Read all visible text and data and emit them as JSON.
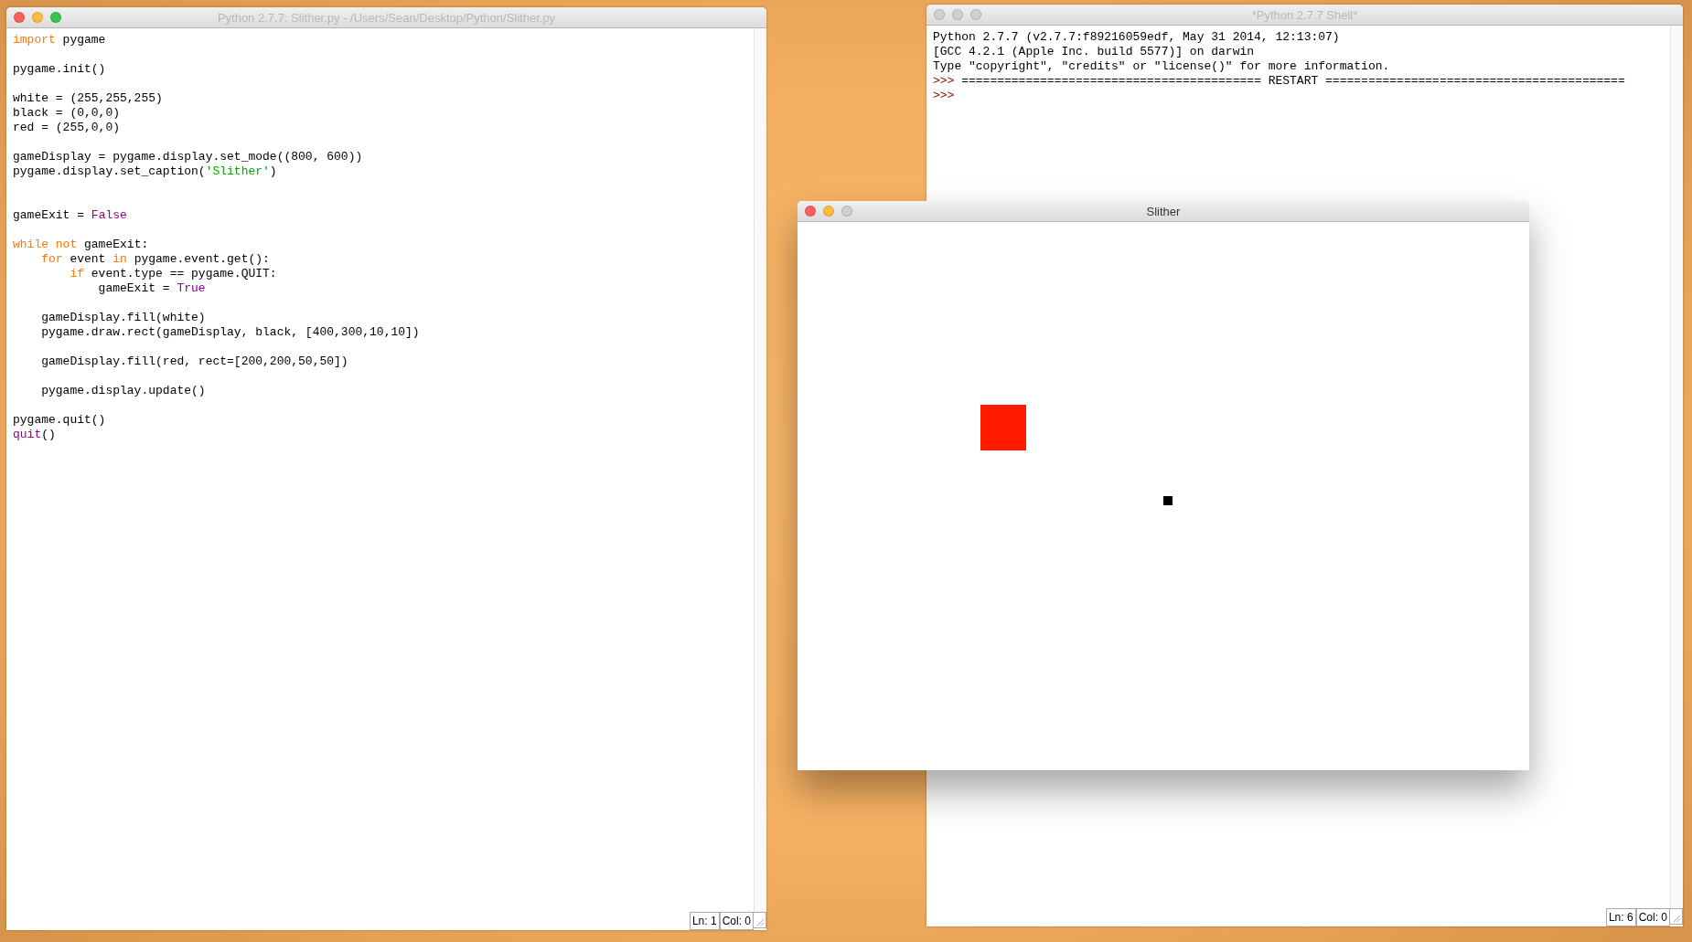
{
  "editor": {
    "title": "Python 2.7.7: Slither.py - /Users/Sean/Desktop/Python/Slither.py",
    "lines": [
      {
        "kind": "code",
        "tokens": [
          {
            "kind": "keyword",
            "text": "import"
          },
          {
            "kind": "plain",
            "text": " pygame"
          }
        ]
      },
      {
        "kind": "blank"
      },
      {
        "kind": "code",
        "tokens": [
          {
            "kind": "plain",
            "text": "pygame.init()"
          }
        ]
      },
      {
        "kind": "blank"
      },
      {
        "kind": "code",
        "tokens": [
          {
            "kind": "plain",
            "text": "white = (255,255,255)"
          }
        ]
      },
      {
        "kind": "code",
        "tokens": [
          {
            "kind": "plain",
            "text": "black = (0,0,0)"
          }
        ]
      },
      {
        "kind": "code",
        "tokens": [
          {
            "kind": "plain",
            "text": "red = (255,0,0)"
          }
        ]
      },
      {
        "kind": "blank"
      },
      {
        "kind": "code",
        "tokens": [
          {
            "kind": "plain",
            "text": "gameDisplay = pygame.display.set_mode((800, 600))"
          }
        ]
      },
      {
        "kind": "code",
        "tokens": [
          {
            "kind": "plain",
            "text": "pygame.display.set_caption("
          },
          {
            "kind": "string",
            "text": "'Slither'"
          },
          {
            "kind": "plain",
            "text": ")"
          }
        ]
      },
      {
        "kind": "blank"
      },
      {
        "kind": "blank"
      },
      {
        "kind": "code",
        "tokens": [
          {
            "kind": "plain",
            "text": "gameExit = "
          },
          {
            "kind": "builtin",
            "text": "False"
          }
        ]
      },
      {
        "kind": "blank"
      },
      {
        "kind": "code",
        "tokens": [
          {
            "kind": "keyword",
            "text": "while not"
          },
          {
            "kind": "plain",
            "text": " gameExit:"
          }
        ]
      },
      {
        "kind": "code",
        "tokens": [
          {
            "kind": "keyword",
            "text": "    for"
          },
          {
            "kind": "plain",
            "text": " event "
          },
          {
            "kind": "keyword",
            "text": "in"
          },
          {
            "kind": "plain",
            "text": " pygame.event.get():"
          }
        ]
      },
      {
        "kind": "code",
        "tokens": [
          {
            "kind": "keyword",
            "text": "        if"
          },
          {
            "kind": "plain",
            "text": " event.type == pygame.QUIT:"
          }
        ]
      },
      {
        "kind": "code",
        "tokens": [
          {
            "kind": "plain",
            "text": "            gameExit = "
          },
          {
            "kind": "builtin",
            "text": "True"
          }
        ]
      },
      {
        "kind": "blank"
      },
      {
        "kind": "code",
        "tokens": [
          {
            "kind": "plain",
            "text": "    gameDisplay.fill(white)"
          }
        ]
      },
      {
        "kind": "code",
        "tokens": [
          {
            "kind": "plain",
            "text": "    pygame.draw.rect(gameDisplay, black, [400,300,10,10])"
          }
        ]
      },
      {
        "kind": "blank"
      },
      {
        "kind": "code",
        "tokens": [
          {
            "kind": "plain",
            "text": "    gameDisplay.fill(red, rect=[200,200,50,50])"
          }
        ]
      },
      {
        "kind": "blank"
      },
      {
        "kind": "code",
        "tokens": [
          {
            "kind": "plain",
            "text": "    pygame.display.update()"
          }
        ]
      },
      {
        "kind": "blank"
      },
      {
        "kind": "code",
        "tokens": [
          {
            "kind": "plain",
            "text": "pygame.quit()"
          }
        ]
      },
      {
        "kind": "code",
        "tokens": [
          {
            "kind": "builtin",
            "text": "quit"
          },
          {
            "kind": "plain",
            "text": "()"
          }
        ]
      }
    ],
    "status": {
      "line": "Ln: 1",
      "column": "Col: 0"
    }
  },
  "shell": {
    "title": "*Python 2.7.7 Shell*",
    "lines": [
      [
        {
          "kind": "output",
          "text": "Python 2.7.7 (v2.7.7:f89216059edf, May 31 2014, 12:13:07)"
        }
      ],
      [
        {
          "kind": "output",
          "text": "[GCC 4.2.1 (Apple Inc. build 5577)] on darwin"
        }
      ],
      [
        {
          "kind": "output",
          "text": "Type \"copyright\", \"credits\" or \"license()\" for more information."
        }
      ],
      [
        {
          "kind": "prompt",
          "text": ">>>"
        },
        {
          "kind": "output",
          "text": " ========================================== RESTART =========================================="
        }
      ],
      [
        {
          "kind": "prompt",
          "text": ">>>"
        }
      ]
    ],
    "status": {
      "line": "Ln: 6",
      "column": "Col: 0"
    }
  },
  "game_window": {
    "title": "Slither"
  }
}
